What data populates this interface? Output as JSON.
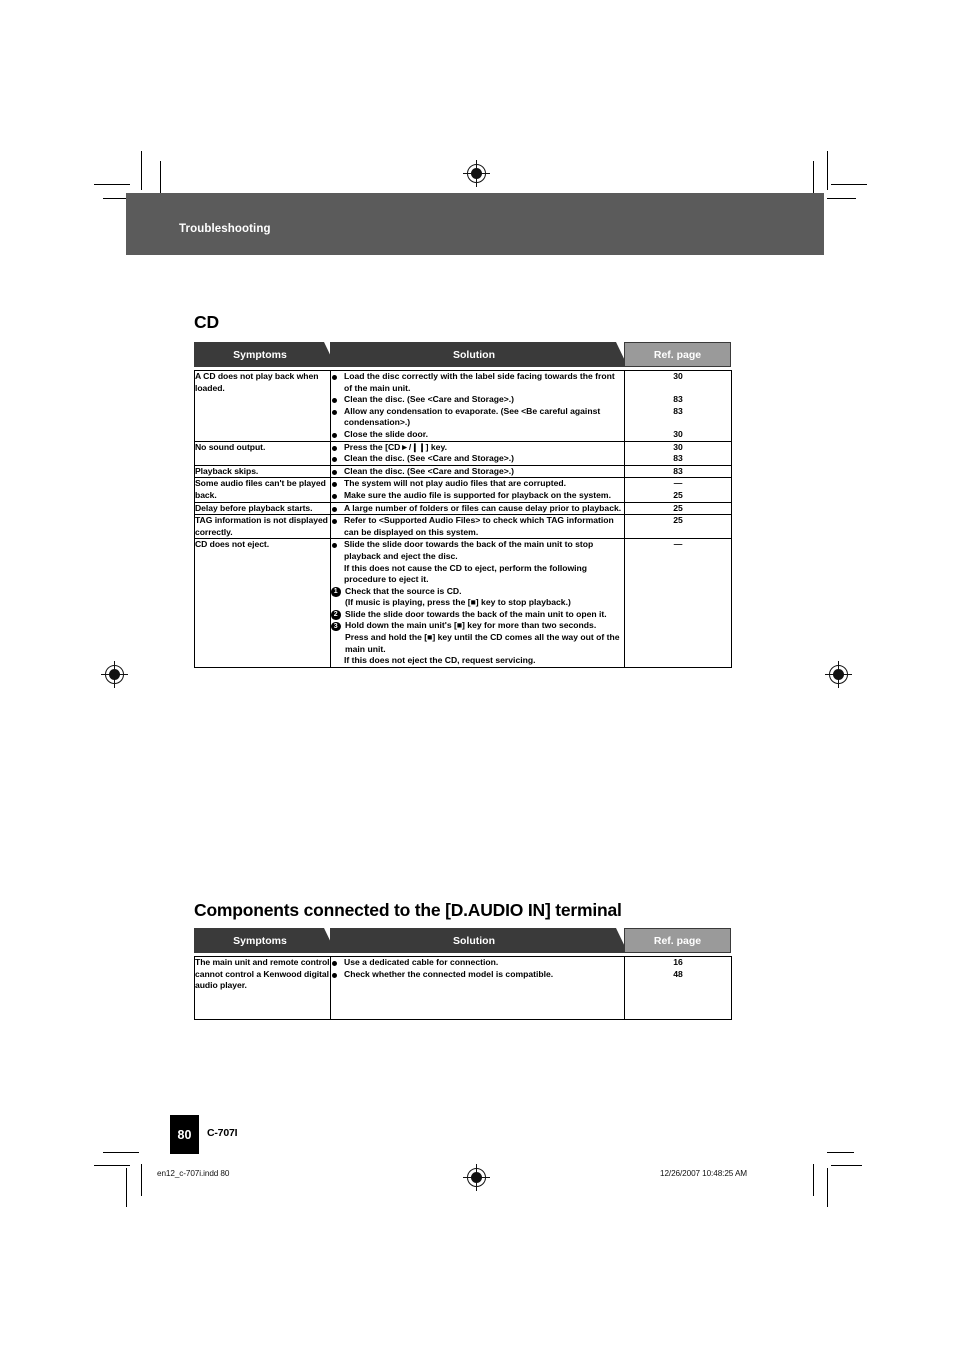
{
  "page": {
    "running_head": "Troubleshooting",
    "page_number": "80",
    "model": "C-707I",
    "footer_file": "en12_c-707i.indd   80",
    "footer_timestamp": "12/26/2007   10:48:25 AM",
    "band_color": "#5b5b5b",
    "tab_dark_color": "#3a3a3a",
    "tab_grey_color": "#9a9a9a"
  },
  "sections": [
    {
      "title": "CD",
      "columns": {
        "symptoms": "Symptoms",
        "solution": "Solution",
        "ref_page": "Ref. page"
      },
      "rows": [
        {
          "symptom": "A CD does not play back when loaded.",
          "solutions": [
            {
              "type": "bullet",
              "text": "Load the disc correctly with the label side facing towards the front of the main unit.",
              "lines": 2
            },
            {
              "type": "bullet",
              "text": "Clean the disc. (See <Care and Storage>.)",
              "lines": 1
            },
            {
              "type": "bullet",
              "text": "Allow any condensation to evaporate. (See <Be careful against condensation>.)",
              "lines": 2
            },
            {
              "type": "bullet",
              "text": "Close the slide door.",
              "lines": 1
            }
          ],
          "refs": [
            "30",
            "",
            "83",
            "83",
            "",
            "30"
          ]
        },
        {
          "symptom": "No sound output.",
          "solutions": [
            {
              "type": "bullet",
              "text": "Press the [CD►/❙❙] key.",
              "lines": 1
            },
            {
              "type": "bullet",
              "text": "Clean the disc. (See <Care and Storage>.)",
              "lines": 1
            }
          ],
          "refs": [
            "30",
            "83"
          ]
        },
        {
          "symptom": "Playback skips.",
          "solutions": [
            {
              "type": "bullet",
              "text": "Clean the disc. (See <Care and Storage>.)",
              "lines": 1
            }
          ],
          "refs": [
            "83"
          ]
        },
        {
          "symptom": "Some audio files can't be played back.",
          "solutions": [
            {
              "type": "bullet",
              "text": "The system will not play audio files that are corrupted.",
              "lines": 1
            },
            {
              "type": "bullet",
              "text": "Make sure the audio file is supported for playback on the system.",
              "lines": 2
            }
          ],
          "refs": [
            "—",
            "25"
          ]
        },
        {
          "symptom": "Delay before playback starts.",
          "solutions": [
            {
              "type": "bullet",
              "text": "A large number of folders or files can cause delay prior to playback.",
              "lines": 2
            }
          ],
          "refs": [
            "25"
          ]
        },
        {
          "symptom": "TAG information is not displayed correctly.",
          "solutions": [
            {
              "type": "bullet",
              "text": "Refer to <Supported Audio Files> to check which TAG information can be displayed on this system.",
              "lines": 2
            }
          ],
          "refs": [
            "25"
          ]
        },
        {
          "symptom": "CD does not eject.",
          "solutions": [
            {
              "type": "bullet",
              "text": "Slide the slide door towards the back of the main unit to stop playback and eject the disc.",
              "lines": 2
            },
            {
              "type": "plain",
              "text": "If this does not cause the CD to eject, perform the following procedure to eject it.",
              "lines": 2
            },
            {
              "type": "step",
              "number": "1",
              "text": "Check that the source is CD.",
              "lines": 1
            },
            {
              "type": "step_cont",
              "text": "(If music is playing, press the [■] key to stop playback.)",
              "lines": 2
            },
            {
              "type": "step",
              "number": "2",
              "text": "Slide the slide door towards the back of the main unit to open it.",
              "lines": 2
            },
            {
              "type": "step",
              "number": "3",
              "text": "Hold down the main unit's [■] key for more than two seconds.",
              "lines": 2
            },
            {
              "type": "step_cont",
              "text": "Press and hold the [■] key until the CD comes all the way out of the main unit.",
              "lines": 2
            },
            {
              "type": "plain",
              "text": "If this does not eject the CD, request servicing.",
              "lines": 1
            }
          ],
          "refs": [
            "—"
          ]
        }
      ]
    },
    {
      "title": "Components connected to the [D.AUDIO IN] terminal",
      "columns": {
        "symptoms": "Symptoms",
        "solution": "Solution",
        "ref_page": "Ref. page"
      },
      "rows": [
        {
          "symptom": "The main unit and remote control cannot control a Kenwood digital audio player.",
          "solutions": [
            {
              "type": "bullet",
              "text": "Use a dedicated cable for connection.",
              "lines": 1
            },
            {
              "type": "bullet",
              "text": "Check whether the connected model is compatible.",
              "lines": 1
            }
          ],
          "refs": [
            "16",
            "48"
          ]
        }
      ]
    }
  ]
}
